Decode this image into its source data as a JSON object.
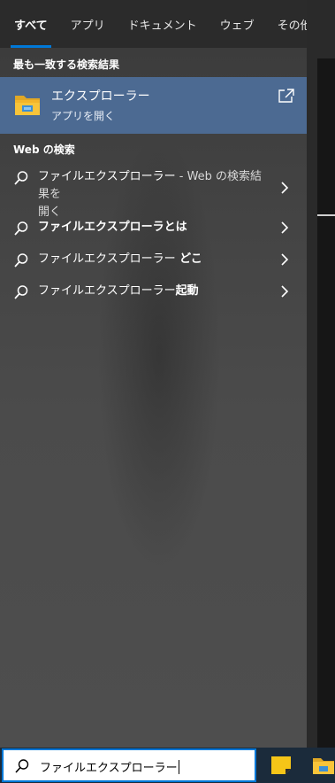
{
  "tabs": [
    {
      "label": "すべて",
      "active": true
    },
    {
      "label": "アプリ",
      "active": false
    },
    {
      "label": "ドキュメント",
      "active": false
    },
    {
      "label": "ウェブ",
      "active": false
    },
    {
      "label": "その他",
      "active": false
    }
  ],
  "best_match": {
    "section_title": "最も一致する検索結果",
    "name": "エクスプローラー",
    "subtitle": "アプリを開く",
    "icon": "file-explorer-folder-icon"
  },
  "web": {
    "section_title": "Web の検索",
    "results": [
      {
        "main": "ファイルエクスプローラー",
        "suffix": " - Web の検索結果を",
        "line2": "開く"
      },
      {
        "main": "ファイルエクスプローラとは"
      },
      {
        "main": "ファイルエクスプローラー",
        "suffix": " どこ"
      },
      {
        "main": "ファイルエクスプローラー",
        "suffix": "起動"
      }
    ]
  },
  "searchbox": {
    "query": "ファイルエクスプローラー"
  },
  "colors": {
    "accent": "#0078d7",
    "selection": "#4c6a92",
    "taskbar": "#1b2b3b"
  }
}
